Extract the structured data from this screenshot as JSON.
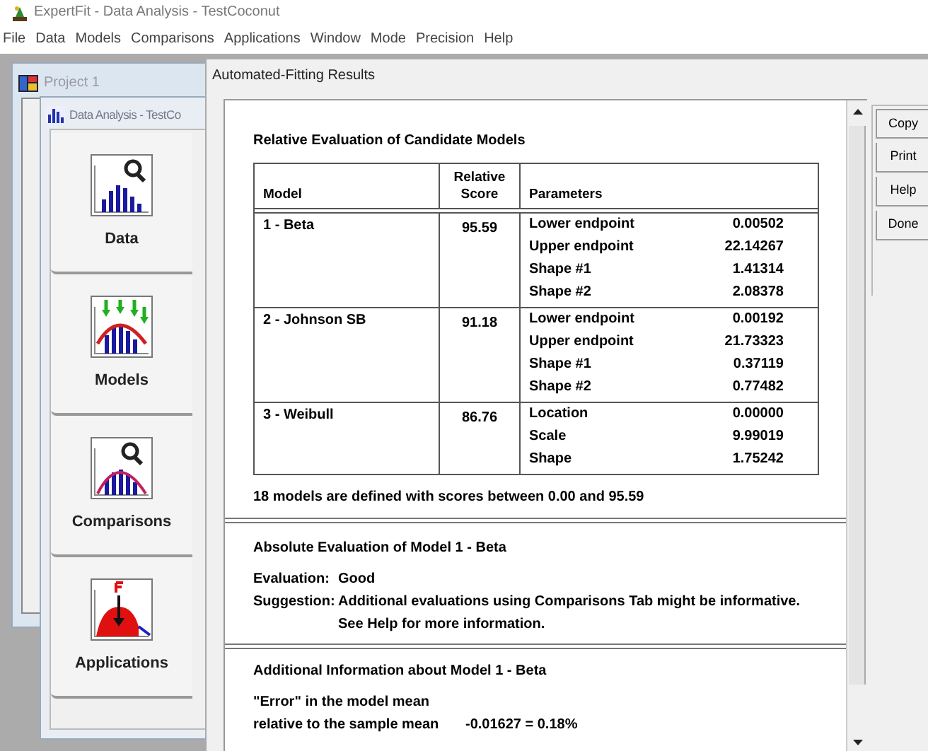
{
  "app_title": "ExpertFit - Data Analysis - TestCoconut",
  "menu": [
    "File",
    "Data",
    "Models",
    "Comparisons",
    "Applications",
    "Window",
    "Mode",
    "Precision",
    "Help"
  ],
  "project_window": {
    "title": "Project 1"
  },
  "analysis_window": {
    "title": "Data Analysis - TestCo",
    "tabs": [
      {
        "kind": "data",
        "label": "Data"
      },
      {
        "kind": "models",
        "label": "Models"
      },
      {
        "kind": "comparisons",
        "label": "Comparisons"
      },
      {
        "kind": "applications",
        "label": "Applications"
      }
    ]
  },
  "dialog": {
    "title": "Automated-Fitting Results",
    "buttons": [
      "Copy",
      "Print",
      "Help",
      "Done"
    ],
    "relative": {
      "heading": "Relative Evaluation of Candidate Models",
      "columns": [
        "Model",
        "Relative Score",
        "Parameters"
      ],
      "rows": [
        {
          "model": "1 - Beta",
          "score": "95.59",
          "parameters": [
            {
              "name": "Lower endpoint",
              "value": "0.00502"
            },
            {
              "name": "Upper endpoint",
              "value": "22.14267"
            },
            {
              "name": "Shape #1",
              "value": "1.41314"
            },
            {
              "name": "Shape #2",
              "value": "2.08378"
            }
          ]
        },
        {
          "model": "2 - Johnson SB",
          "score": "91.18",
          "parameters": [
            {
              "name": "Lower endpoint",
              "value": "0.00192"
            },
            {
              "name": "Upper endpoint",
              "value": "21.73323"
            },
            {
              "name": "Shape #1",
              "value": "0.37119"
            },
            {
              "name": "Shape #2",
              "value": "0.77482"
            }
          ]
        },
        {
          "model": "3 - Weibull",
          "score": "86.76",
          "parameters": [
            {
              "name": "Location",
              "value": "0.00000"
            },
            {
              "name": "Scale",
              "value": "9.99019"
            },
            {
              "name": "Shape",
              "value": "1.75242"
            }
          ]
        }
      ],
      "note": "18 models are defined with scores between 0.00 and 95.59"
    },
    "absolute": {
      "heading": "Absolute Evaluation of Model 1 - Beta",
      "lines": [
        {
          "label": "Evaluation:",
          "text": "Good"
        },
        {
          "label": "Suggestion:",
          "text": "Additional evaluations using Comparisons Tab might be informative."
        },
        {
          "text": "See Help for more information."
        }
      ]
    },
    "additional": {
      "heading": "Additional Information about Model 1 - Beta",
      "line_1": "\"Error\" in the model mean",
      "line_2_label": "relative to the sample mean",
      "line_2_value": "-0.01627 = 0.18%"
    }
  }
}
